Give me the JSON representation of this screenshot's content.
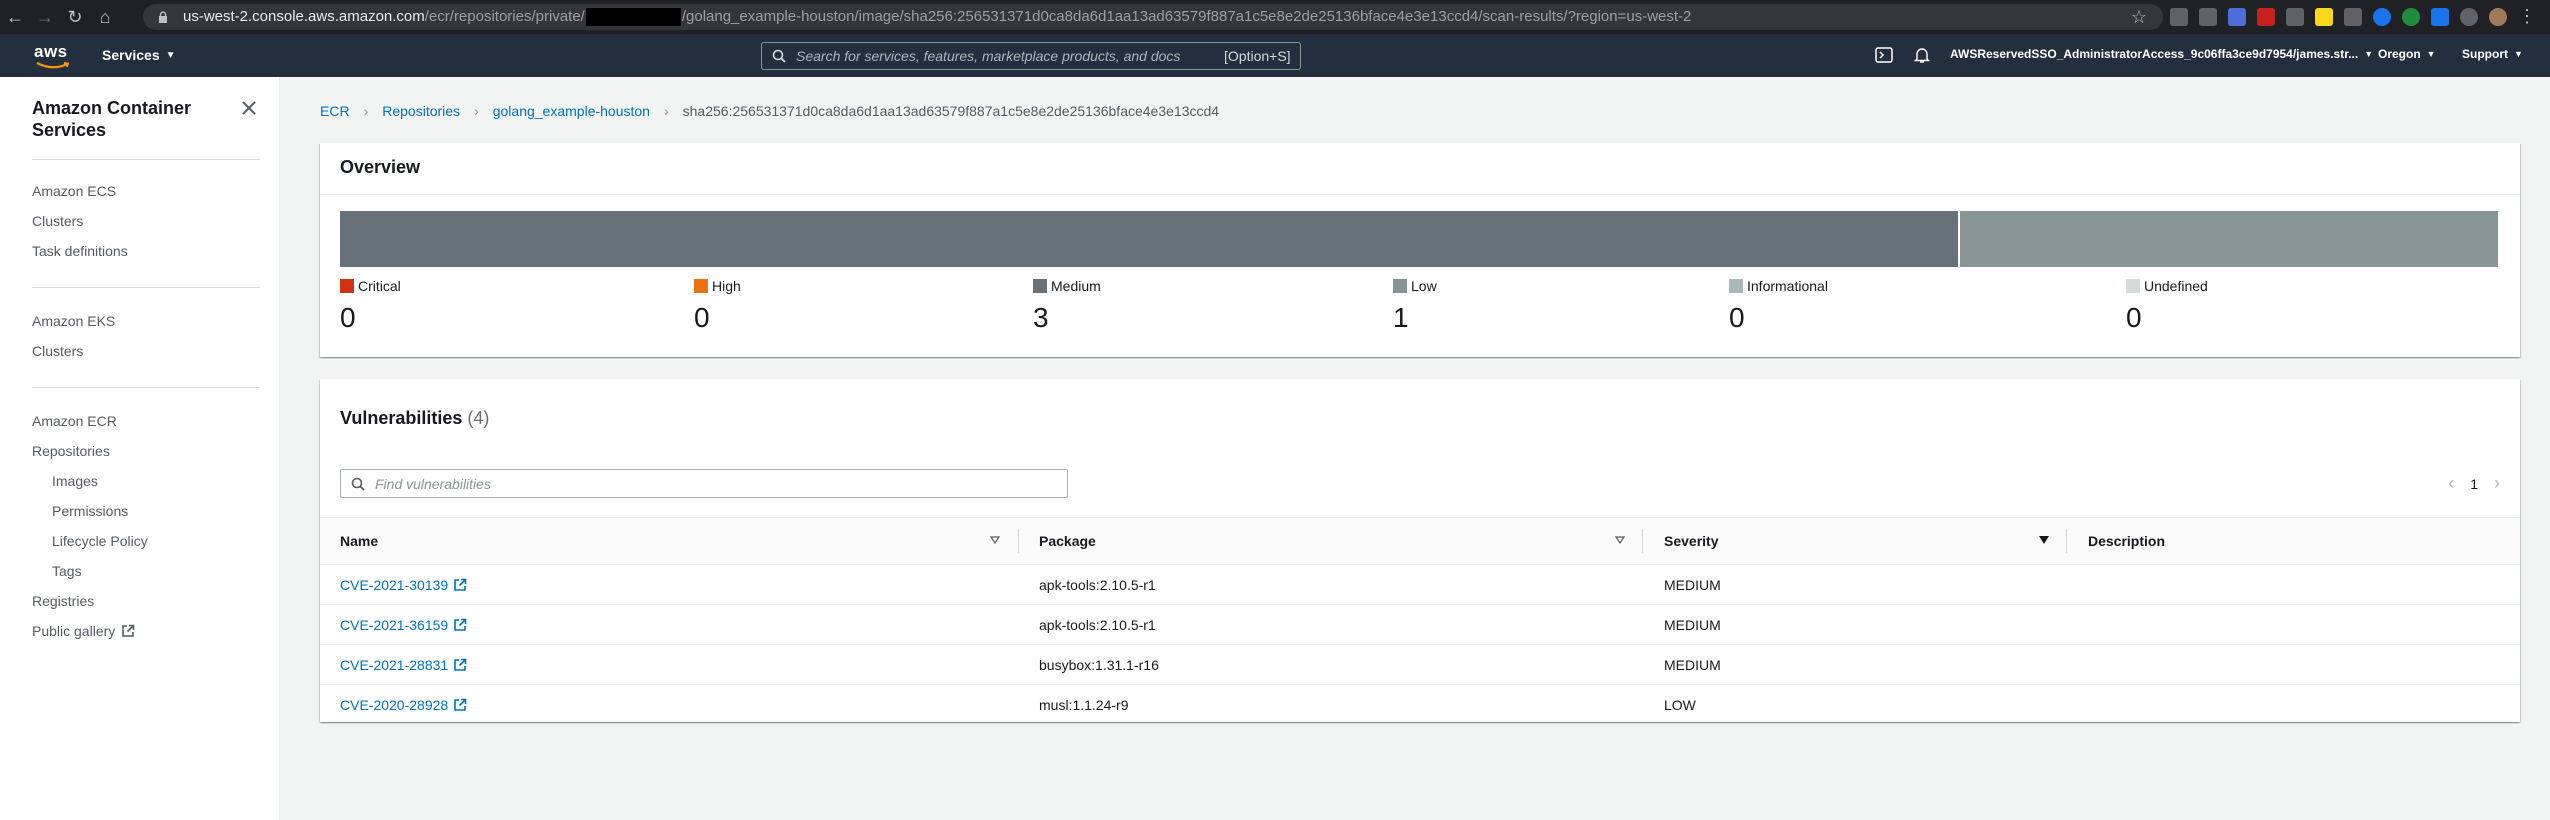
{
  "browser": {
    "url_host": "us-west-2.console.aws.amazon.com",
    "url_path_1": "/ecr/repositories/private/",
    "url_path_2": "/golang_example-houston/image/sha256:256531371d0ca8da6d1aa13ad63579f887a1c5e8e2de25136bface4e3e13ccd4/scan-results/?region=us-west-2"
  },
  "header": {
    "logo_text": "aws",
    "services_label": "Services",
    "search_placeholder": "Search for services, features, marketplace products, and docs",
    "search_shortcut": "[Option+S]",
    "account": "AWSReservedSSO_AdministratorAccess_9c06ffa3ce9d7954/james.str...",
    "region": "Oregon",
    "support": "Support"
  },
  "sidebar": {
    "title": "Amazon Container Services",
    "groups": [
      {
        "items": [
          {
            "label": "Amazon ECS"
          },
          {
            "label": "Clusters"
          },
          {
            "label": "Task definitions"
          }
        ]
      },
      {
        "items": [
          {
            "label": "Amazon EKS"
          },
          {
            "label": "Clusters"
          }
        ]
      },
      {
        "items": [
          {
            "label": "Amazon ECR"
          },
          {
            "label": "Repositories"
          },
          {
            "label": "Images"
          },
          {
            "label": "Permissions"
          },
          {
            "label": "Lifecycle Policy"
          },
          {
            "label": "Tags"
          },
          {
            "label": "Registries"
          },
          {
            "label": "Public gallery"
          }
        ]
      }
    ]
  },
  "breadcrumb": [
    "ECR",
    "Repositories",
    "golang_example-houston",
    "sha256:256531371d0ca8da6d1aa13ad63579f887a1c5e8e2de25136bface4e3e13ccd4"
  ],
  "overview": {
    "title": "Overview",
    "severities": [
      {
        "label": "Critical",
        "count": "0",
        "color": "#d13212"
      },
      {
        "label": "High",
        "count": "0",
        "color": "#ec7211"
      },
      {
        "label": "Medium",
        "count": "3",
        "color": "#687078"
      },
      {
        "label": "Low",
        "count": "1",
        "color": "#879596"
      },
      {
        "label": "Informational",
        "count": "0",
        "color": "#aab7b8"
      },
      {
        "label": "Undefined",
        "count": "0",
        "color": "#d5dbdb"
      }
    ]
  },
  "vulnerabilities": {
    "title": "Vulnerabilities",
    "count": "(4)",
    "filter_placeholder": "Find vulnerabilities",
    "page": "1",
    "columns": [
      "Name",
      "Package",
      "Severity",
      "Description"
    ],
    "rows": [
      {
        "name": "CVE-2021-30139",
        "package": "apk-tools:2.10.5-r1",
        "severity": "MEDIUM",
        "description": ""
      },
      {
        "name": "CVE-2021-36159",
        "package": "apk-tools:2.10.5-r1",
        "severity": "MEDIUM",
        "description": ""
      },
      {
        "name": "CVE-2021-28831",
        "package": "busybox:1.31.1-r16",
        "severity": "MEDIUM",
        "description": ""
      },
      {
        "name": "CVE-2020-28928",
        "package": "musl:1.1.24-r9",
        "severity": "LOW",
        "description": ""
      }
    ]
  }
}
